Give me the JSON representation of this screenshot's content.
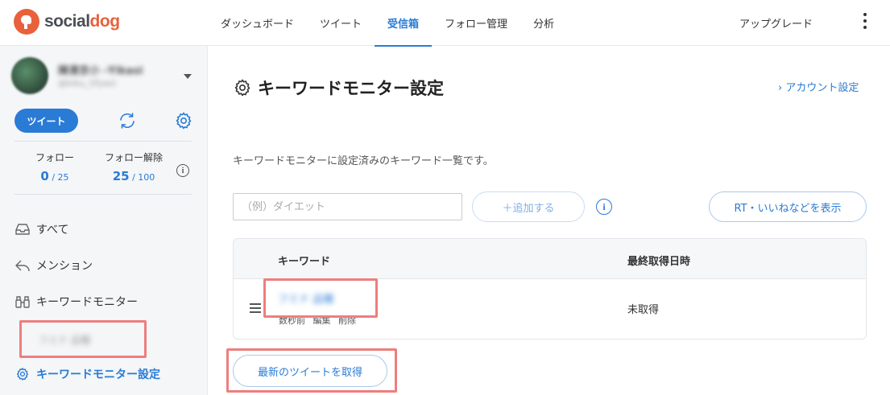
{
  "brand": {
    "logo_part1": "social",
    "logo_part2": "dog"
  },
  "nav": {
    "items": [
      "ダッシュボード",
      "ツイート",
      "受信箱",
      "フォロー管理",
      "分析"
    ],
    "active_index": 2,
    "upgrade": "アップグレード"
  },
  "sidebar": {
    "account_name": "陳清京小 -Yikasi",
    "account_handle": "@kiku_tifyasi",
    "tweet_button": "ツイート",
    "follow": {
      "label": "フォロー",
      "count": "0",
      "limit": " / 25"
    },
    "unfollow": {
      "label": "フォロー解除",
      "count": "25",
      "limit": " / 100"
    },
    "info_symbol": "i",
    "menu": {
      "all": "すべて",
      "mentions": "メンション",
      "keyword_monitor": "キーワードモニター",
      "keyword_sub": "フミナ 品種",
      "keyword_settings": "キーワードモニター設定"
    }
  },
  "main": {
    "title": "キーワードモニター設定",
    "account_settings_link": "› アカウント設定",
    "description": "キーワードモニターに設定済みのキーワード一覧です。",
    "input_placeholder": "（例）ダイエット",
    "add_button": "＋追加する",
    "info_symbol": "i",
    "rt_button": "RT・いいねなどを表示",
    "table": {
      "headers": {
        "keyword": "キーワード",
        "last_fetched": "最終取得日時"
      },
      "rows": [
        {
          "keyword": "フミナ 品種",
          "meta": [
            "数秒前",
            "編集",
            "削除"
          ],
          "last_fetched": "未取得"
        }
      ]
    },
    "fetch_button": "最新のツイートを取得"
  },
  "colors": {
    "accent": "#2a7bd5",
    "brand": "#e8613c",
    "highlight": "#ee7e7e",
    "sidebar_bg": "#f4f6f8"
  }
}
